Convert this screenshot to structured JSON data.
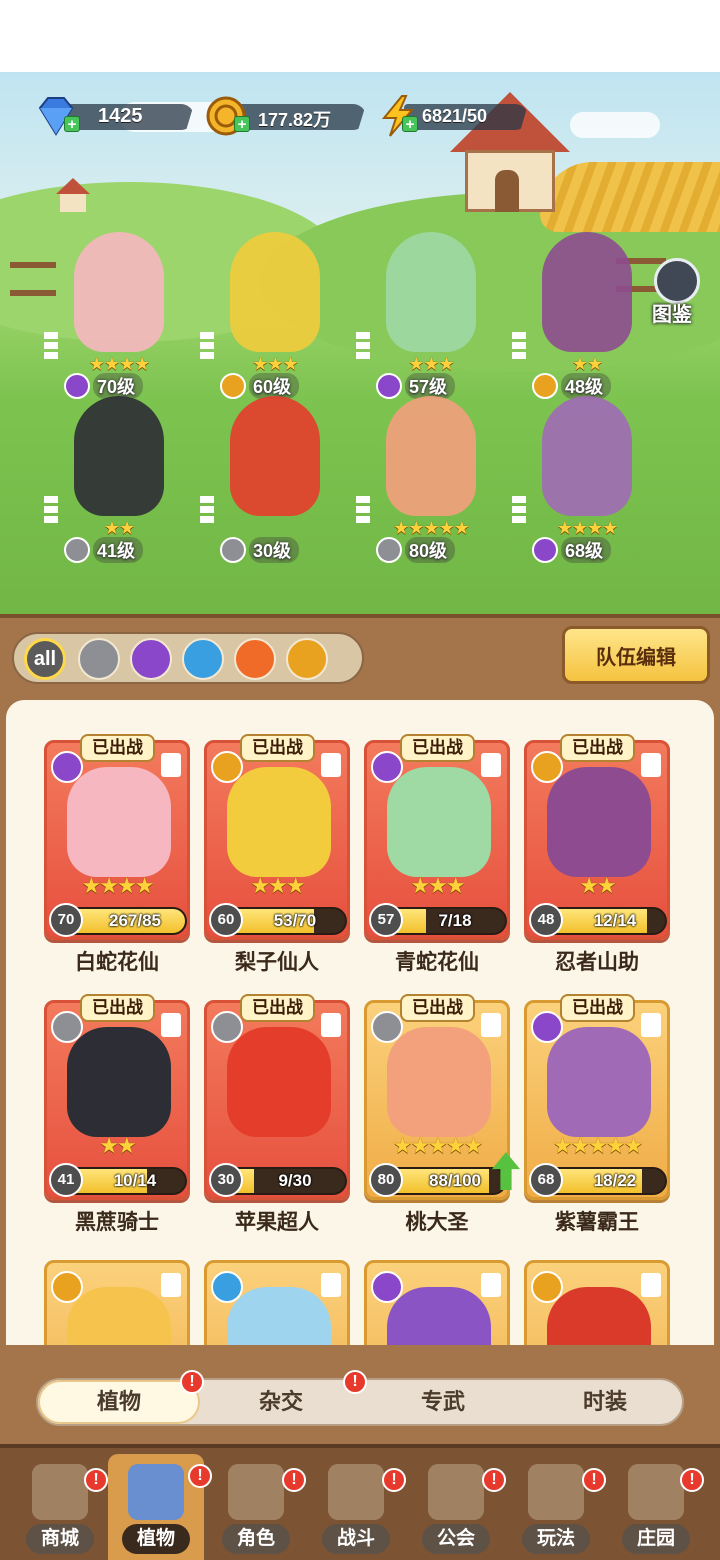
{
  "currencies": {
    "gems": "1425",
    "coins": "177.82万",
    "energy": "6821/50"
  },
  "codex_label": "图鉴",
  "heroes": [
    {
      "level": "70级",
      "stars": "★★★★",
      "element": "purple"
    },
    {
      "level": "60级",
      "stars": "★★★",
      "element": "lightning"
    },
    {
      "level": "57级",
      "stars": "★★★",
      "element": "purple"
    },
    {
      "level": "48级",
      "stars": "★★",
      "element": "lightning"
    },
    {
      "level": "41级",
      "stars": "★★",
      "element": "sword"
    },
    {
      "level": "30级",
      "stars": "",
      "element": "sword"
    },
    {
      "level": "80级",
      "stars": "★★★★★",
      "element": "sword"
    },
    {
      "level": "68级",
      "stars": "★★★★",
      "element": "purple"
    }
  ],
  "filters": [
    "all",
    "sword",
    "potion",
    "water",
    "fire",
    "lightning"
  ],
  "team_edit_label": "队伍编辑",
  "deployed_label": "已出战",
  "cards": [
    {
      "name": "白蛇花仙",
      "level": "70",
      "progress": "267/85",
      "stars": "★★★★",
      "element": "purple",
      "deployed": true,
      "fill": 1.0,
      "gold": false
    },
    {
      "name": "梨子仙人",
      "level": "60",
      "progress": "53/70",
      "stars": "★★★",
      "element": "lightning",
      "deployed": true,
      "fill": 0.76,
      "gold": false
    },
    {
      "name": "青蛇花仙",
      "level": "57",
      "progress": "7/18",
      "stars": "★★★",
      "element": "purple",
      "deployed": true,
      "fill": 0.39,
      "gold": false
    },
    {
      "name": "忍者山助",
      "level": "48",
      "progress": "12/14",
      "stars": "★★",
      "element": "lightning",
      "deployed": true,
      "fill": 0.86,
      "gold": false
    },
    {
      "name": "黑蔗骑士",
      "level": "41",
      "progress": "10/14",
      "stars": "★★",
      "element": "sword",
      "deployed": true,
      "fill": 0.71,
      "gold": false
    },
    {
      "name": "苹果超人",
      "level": "30",
      "progress": "9/30",
      "stars": "",
      "element": "sword",
      "deployed": true,
      "fill": 0.3,
      "gold": false
    },
    {
      "name": "桃大圣",
      "level": "80",
      "progress": "88/100",
      "stars": "★★★★★",
      "element": "sword",
      "deployed": true,
      "fill": 0.88,
      "gold": true
    },
    {
      "name": "紫薯霸王",
      "level": "68",
      "progress": "18/22",
      "stars": "★★★★★",
      "element": "purple",
      "deployed": true,
      "fill": 0.82,
      "gold": true
    },
    {
      "name": "",
      "level": "",
      "progress": "",
      "stars": "",
      "element": "lightning",
      "deployed": false,
      "fill": 0,
      "gold": true
    },
    {
      "name": "",
      "level": "",
      "progress": "",
      "stars": "",
      "element": "water",
      "deployed": false,
      "fill": 0,
      "gold": true
    },
    {
      "name": "",
      "level": "",
      "progress": "",
      "stars": "",
      "element": "purple",
      "deployed": false,
      "fill": 0,
      "gold": true
    },
    {
      "name": "",
      "level": "",
      "progress": "",
      "stars": "",
      "element": "lightning",
      "deployed": false,
      "fill": 0,
      "gold": true
    }
  ],
  "subtabs": [
    "植物",
    "杂交",
    "专武",
    "时装"
  ],
  "nav": [
    "商城",
    "植物",
    "角色",
    "战斗",
    "公会",
    "玩法",
    "庄园"
  ],
  "colors": {
    "accent": "#f5c340",
    "panel": "#a4744a",
    "card_red": "#e6503e",
    "card_gold": "#f0ac46"
  }
}
